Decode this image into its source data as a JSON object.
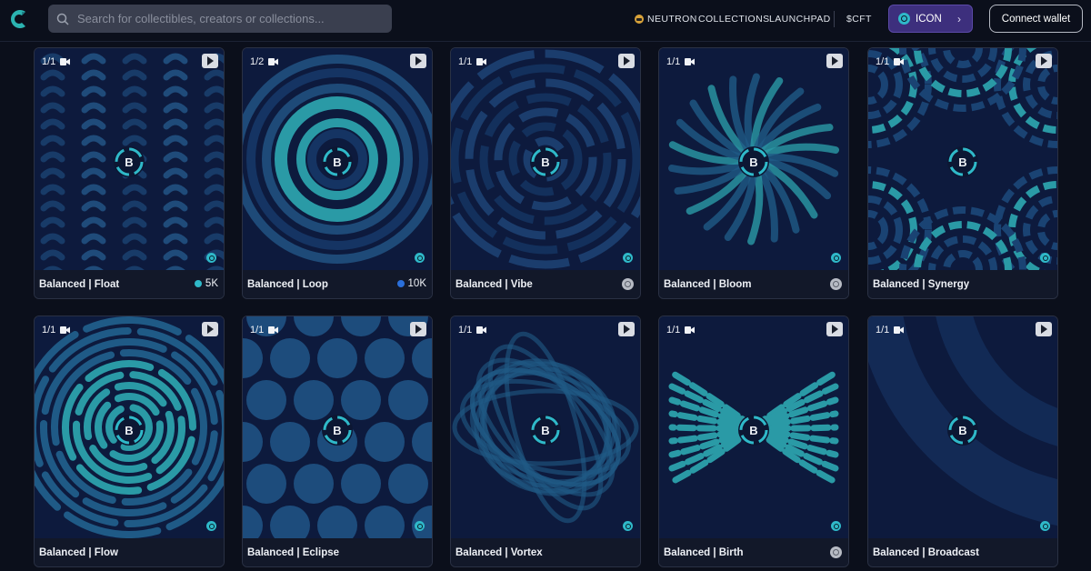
{
  "header": {
    "search_placeholder": "Search for collectibles, creators or collections...",
    "nav": {
      "neutron": "NEUTRON",
      "collections": "COLLECTIONS",
      "launchpad": "LAUNCHPAD",
      "cft": "$CFT"
    },
    "chain_button": "ICON",
    "connect_wallet": "Connect wallet"
  },
  "badge_letter": "B",
  "cards": [
    {
      "title": "Balanced | Float",
      "edition": "1/1",
      "price": "5K",
      "price_coin": "cyan",
      "chain": "icon"
    },
    {
      "title": "Balanced | Loop",
      "edition": "1/2",
      "price": "10K",
      "price_coin": "blue",
      "chain": "icon"
    },
    {
      "title": "Balanced | Vibe",
      "edition": "1/1",
      "price": "",
      "chain": "gray"
    },
    {
      "title": "Balanced | Bloom",
      "edition": "1/1",
      "price": "",
      "chain": "gray"
    },
    {
      "title": "Balanced | Synergy",
      "edition": "1/1",
      "price": "",
      "chain": "none"
    },
    {
      "title": "Balanced | Flow",
      "edition": "1/1",
      "price": "",
      "chain": "none"
    },
    {
      "title": "Balanced | Eclipse",
      "edition": "1/1",
      "price": "",
      "chain": "none"
    },
    {
      "title": "Balanced | Vortex",
      "edition": "1/1",
      "price": "",
      "chain": "none"
    },
    {
      "title": "Balanced | Birth",
      "edition": "1/1",
      "price": "",
      "chain": "gray"
    },
    {
      "title": "Balanced | Broadcast",
      "edition": "1/1",
      "price": "",
      "chain": "none"
    }
  ],
  "colors": {
    "background": "#0b0f1b",
    "art_dark": "#0d1a3d",
    "art_teal": "#2a9aa6",
    "chain_button_bg": "#3d2f7d",
    "icon_coin": "#2fb9c9"
  }
}
